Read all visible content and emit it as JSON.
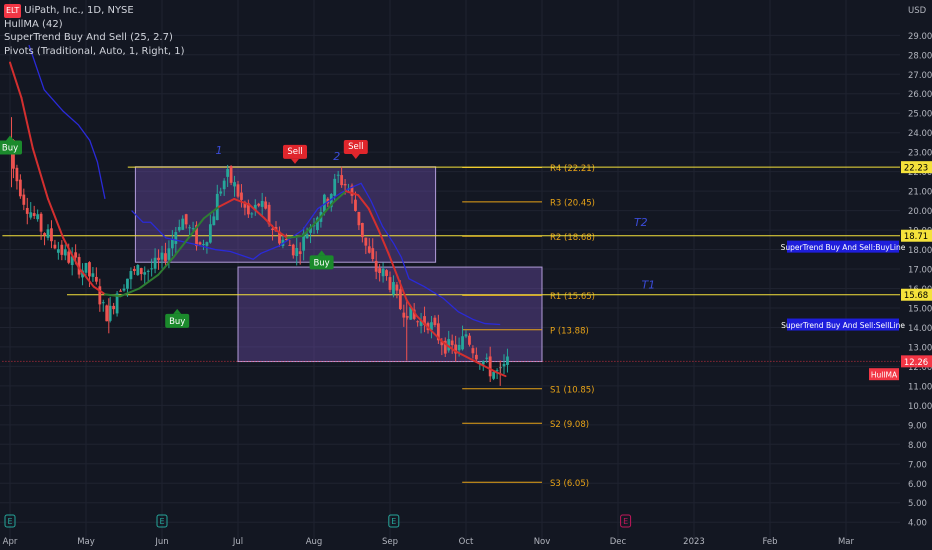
{
  "legend": {
    "badge": "ELT",
    "symbol": "UiPath, Inc., 1D, NYSE",
    "hull": "HullMA (42)",
    "supertrend": "SuperTrend Buy And Sell (25, 2.7)",
    "pivots": "Pivots (Traditional, Auto, 1, Right, 1)"
  },
  "colors": {
    "background": "#131722",
    "grid": "#1f2330",
    "up": "#26a69a",
    "down": "#ef5350",
    "hull_up": "#2e7d32",
    "hull_down": "#d32f2f",
    "supertrend": "#2a2ad8",
    "pivot": "#e8a317",
    "box": "#7e57c2",
    "level_line": "#f5e23b",
    "price_tag": "#f23645",
    "blue_tag": "#1e1edc",
    "yellow_tag": "#f5e23b"
  },
  "chart_data": {
    "type": "candlestick",
    "currency": "USD",
    "y_ticks": [
      "4.00",
      "5.00",
      "6.00",
      "7.00",
      "8.00",
      "9.00",
      "10.00",
      "11.00",
      "12.00",
      "13.00",
      "14.00",
      "15.00",
      "16.00",
      "17.00",
      "18.00",
      "19.00",
      "20.00",
      "21.00",
      "22.00",
      "23.00",
      "24.00",
      "25.00",
      "26.00",
      "27.00",
      "28.00",
      "29.00"
    ],
    "ylim": [
      3.6,
      30.3
    ],
    "x_labels": [
      {
        "label": "Apr",
        "x": 0
      },
      {
        "label": "May",
        "x": 1
      },
      {
        "label": "Jun",
        "x": 2
      },
      {
        "label": "Jul",
        "x": 3
      },
      {
        "label": "Aug",
        "x": 4
      },
      {
        "label": "Sep",
        "x": 5
      },
      {
        "label": "Oct",
        "x": 6
      },
      {
        "label": "Nov",
        "x": 7
      },
      {
        "label": "Dec",
        "x": 8
      },
      {
        "label": "2023",
        "x": 9
      },
      {
        "label": "Feb",
        "x": 10
      },
      {
        "label": "Mar",
        "x": 11
      }
    ],
    "price_path": [
      [
        0.0,
        23.6
      ],
      [
        0.05,
        22.0
      ],
      [
        0.12,
        21.3
      ],
      [
        0.2,
        20.4
      ],
      [
        0.3,
        19.8
      ],
      [
        0.42,
        19.0
      ],
      [
        0.55,
        18.5
      ],
      [
        0.7,
        17.8
      ],
      [
        0.85,
        17.3
      ],
      [
        1.0,
        16.9
      ],
      [
        1.12,
        16.3
      ],
      [
        1.22,
        15.0
      ],
      [
        1.3,
        14.6
      ],
      [
        1.42,
        16.0
      ],
      [
        1.55,
        16.6
      ],
      [
        1.7,
        16.9
      ],
      [
        1.85,
        17.0
      ],
      [
        2.0,
        17.4
      ],
      [
        2.12,
        18.4
      ],
      [
        2.25,
        19.7
      ],
      [
        2.38,
        18.9
      ],
      [
        2.5,
        18.2
      ],
      [
        2.62,
        19.0
      ],
      [
        2.75,
        21.0
      ],
      [
        2.85,
        21.8
      ],
      [
        2.95,
        21.3
      ],
      [
        3.05,
        20.4
      ],
      [
        3.15,
        19.6
      ],
      [
        3.28,
        20.4
      ],
      [
        3.4,
        19.5
      ],
      [
        3.52,
        18.7
      ],
      [
        3.65,
        18.3
      ],
      [
        3.78,
        17.9
      ],
      [
        3.9,
        18.9
      ],
      [
        4.05,
        19.9
      ],
      [
        4.2,
        20.8
      ],
      [
        4.32,
        21.7
      ],
      [
        4.45,
        21.2
      ],
      [
        4.58,
        19.6
      ],
      [
        4.7,
        17.9
      ],
      [
        4.8,
        17.0
      ],
      [
        4.9,
        16.8
      ],
      [
        5.0,
        16.3
      ],
      [
        5.08,
        15.6
      ],
      [
        5.15,
        14.9
      ],
      [
        5.22,
        15.0
      ],
      [
        5.3,
        14.4
      ],
      [
        5.4,
        14.3
      ],
      [
        5.5,
        14.3
      ],
      [
        5.62,
        13.6
      ],
      [
        5.75,
        13.0
      ],
      [
        5.9,
        12.8
      ],
      [
        6.0,
        13.7
      ],
      [
        6.1,
        12.9
      ],
      [
        6.22,
        12.3
      ],
      [
        6.32,
        11.8
      ],
      [
        6.45,
        11.6
      ],
      [
        6.55,
        12.2
      ]
    ],
    "wick_events": [
      {
        "x": 0.02,
        "high": 24.8,
        "low": 21.2,
        "label": "early-high"
      },
      {
        "x": 1.3,
        "high": 15.5,
        "low": 13.7,
        "label": "may-low"
      },
      {
        "x": 5.22,
        "high": 15.4,
        "low": 12.3,
        "label": "sep-gap"
      },
      {
        "x": 6.45,
        "high": 12.3,
        "low": 11.0,
        "label": "oct-low"
      }
    ],
    "hull_ma": [
      [
        0.0,
        27.6
      ],
      [
        0.15,
        25.8
      ],
      [
        0.3,
        23.2
      ],
      [
        0.5,
        20.6
      ],
      [
        0.7,
        18.6
      ],
      [
        0.9,
        17.1
      ],
      [
        1.1,
        16.1
      ],
      [
        1.25,
        15.7
      ],
      [
        1.45,
        15.6
      ],
      [
        1.7,
        16.0
      ],
      [
        1.95,
        16.7
      ],
      [
        2.15,
        17.6
      ],
      [
        2.35,
        18.6
      ],
      [
        2.55,
        19.6
      ],
      [
        2.75,
        20.2
      ],
      [
        2.95,
        20.6
      ],
      [
        3.15,
        20.3
      ],
      [
        3.35,
        19.6
      ],
      [
        3.5,
        19.0
      ],
      [
        3.65,
        18.6
      ],
      [
        3.85,
        18.7
      ],
      [
        4.05,
        19.5
      ],
      [
        4.25,
        20.4
      ],
      [
        4.42,
        21.0
      ],
      [
        4.58,
        20.8
      ],
      [
        4.72,
        20.1
      ],
      [
        4.85,
        19.0
      ],
      [
        4.98,
        17.8
      ],
      [
        5.1,
        16.6
      ],
      [
        5.22,
        15.4
      ],
      [
        5.35,
        14.6
      ],
      [
        5.5,
        14.0
      ],
      [
        5.68,
        13.3
      ],
      [
        5.85,
        12.8
      ],
      [
        6.0,
        12.5
      ],
      [
        6.2,
        12.1
      ],
      [
        6.4,
        11.7
      ],
      [
        6.52,
        11.5
      ]
    ],
    "hull_ma_green_segments": [
      [
        1.25,
        2.72
      ],
      [
        3.65,
        4.42
      ]
    ],
    "supertrend_line": [
      [
        0.25,
        28.5
      ],
      [
        0.45,
        26.2
      ],
      [
        0.7,
        25.1
      ],
      [
        0.9,
        24.4
      ],
      [
        1.05,
        23.6
      ],
      [
        1.15,
        22.5
      ],
      [
        1.25,
        20.6
      ],
      [
        1.35,
        20.0
      ],
      [
        1.6,
        20.0
      ],
      [
        1.75,
        19.4
      ],
      [
        1.85,
        19.4
      ],
      [
        1.95,
        19.0
      ],
      [
        2.05,
        18.6
      ],
      [
        2.4,
        18.3
      ],
      [
        2.7,
        18.0
      ],
      [
        2.9,
        17.9
      ],
      [
        3.2,
        17.5
      ],
      [
        3.3,
        17.8
      ],
      [
        3.55,
        18.2
      ],
      [
        3.85,
        19.0
      ],
      [
        4.05,
        20.1
      ],
      [
        4.2,
        20.5
      ],
      [
        4.35,
        20.9
      ],
      [
        4.5,
        21.2
      ],
      [
        4.62,
        21.4
      ],
      [
        4.75,
        20.5
      ],
      [
        4.9,
        19.2
      ],
      [
        5.05,
        18.3
      ],
      [
        5.15,
        17.6
      ],
      [
        5.25,
        16.5
      ],
      [
        5.45,
        16.1
      ],
      [
        5.7,
        15.5
      ],
      [
        5.9,
        14.8
      ],
      [
        6.1,
        14.4
      ],
      [
        6.25,
        14.2
      ],
      [
        6.45,
        14.15
      ]
    ],
    "supertrend_break": [
      1.3,
      1.55
    ],
    "pivots": [
      {
        "name": "R4",
        "label": "R4 (22.21)",
        "value": 22.21
      },
      {
        "name": "R3",
        "label": "R3 (20.45)",
        "value": 20.45
      },
      {
        "name": "R2",
        "label": "R2 (18.68)",
        "value": 18.68
      },
      {
        "name": "R1",
        "label": "R1 (15.65)",
        "value": 15.65
      },
      {
        "name": "P",
        "label": "P (13.88)",
        "value": 13.88
      },
      {
        "name": "S1",
        "label": "S1 (10.85)",
        "value": 10.85
      },
      {
        "name": "S2",
        "label": "S2 (9.08)",
        "value": 9.08
      },
      {
        "name": "S3",
        "label": "S3 (6.05)",
        "value": 6.05
      }
    ],
    "pivot_x_range": [
      5.95,
      7.0
    ],
    "boxes": [
      {
        "x0": 1.65,
        "x1": 5.6,
        "y0": 17.35,
        "y1": 22.25
      },
      {
        "x0": 3.0,
        "x1": 7.0,
        "y0": 12.25,
        "y1": 17.1
      }
    ],
    "level_lines": [
      {
        "value": 22.23,
        "x0": 1.55,
        "tag": "22.23"
      },
      {
        "value": 18.71,
        "x0": -0.1,
        "tag": "18.71"
      },
      {
        "value": 15.68,
        "x0": 0.75,
        "tag": "15.68"
      }
    ],
    "last_price": {
      "value": 12.26,
      "tag": "12.26"
    },
    "price_line_x0": -0.1,
    "signals": [
      {
        "type": "Buy",
        "x": 0.0,
        "value": 23.6,
        "label": "Buy"
      },
      {
        "type": "Sell",
        "x": 3.75,
        "value": 22.4,
        "label": "Sell"
      },
      {
        "type": "Sell",
        "x": 4.55,
        "value": 22.65,
        "label": "Sell"
      },
      {
        "type": "Buy",
        "x": 2.2,
        "value": 14.7,
        "label": "Buy"
      },
      {
        "type": "Buy",
        "x": 4.1,
        "value": 17.7,
        "label": "Buy"
      }
    ],
    "annotations": [
      {
        "text": "1",
        "x": 2.75,
        "value": 22.9
      },
      {
        "text": "2",
        "x": 4.3,
        "value": 22.6
      },
      {
        "text": "T2",
        "x": 8.3,
        "value": 19.2
      },
      {
        "text": "T1",
        "x": 8.4,
        "value": 16.0
      }
    ],
    "right_tags": [
      {
        "text": "SuperTrend Buy And Sell:BuyLine",
        "value": 18.15
      },
      {
        "text": "SuperTrend Buy And Sell:SellLine",
        "value": 14.15
      },
      {
        "text": "HullMA",
        "value": 11.6
      }
    ],
    "earnings_markers": [
      {
        "x": 0.0,
        "label": "E"
      },
      {
        "x": 2.0,
        "label": "E"
      },
      {
        "x": 5.05,
        "label": "E"
      },
      {
        "x": 8.1,
        "label": "E"
      }
    ]
  }
}
